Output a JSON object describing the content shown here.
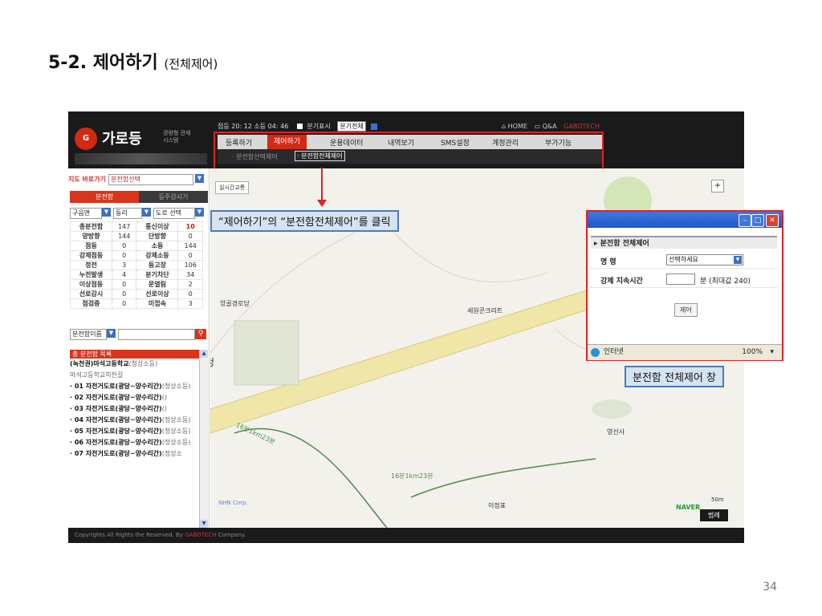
{
  "slide": {
    "title_main": "5-2. 제어하기",
    "title_sub": "(전체제어)",
    "page_number": "34"
  },
  "app": {
    "logo": {
      "mark": "G",
      "name": "가로등",
      "sub": "경량형 관제시스템"
    },
    "status": {
      "time_text": "점등 20: 12 소등 04: 46",
      "checkbox_label": "분기표시",
      "select_value": "분기전체"
    },
    "top_links": {
      "home": "HOME",
      "qa": "Q&A",
      "brand": "GABOTECH"
    },
    "menu": [
      "등록하기",
      "제어하기",
      "운용데이터",
      "내역보기",
      "SMS설정",
      "계정관리",
      "부가기능"
    ],
    "submenu": [
      "· 분전함선택제어",
      "· 분전함전체제어"
    ],
    "sidebar": {
      "goto_label": "지도 바로가기",
      "goto_select": "분전함선택",
      "tabs": [
        "분전함",
        "등주감시기"
      ],
      "filters": [
        "구읍면",
        "동리",
        "도로 선택"
      ],
      "stats": [
        [
          "총분전함",
          "147",
          "통신이상",
          "10"
        ],
        [
          "양방향",
          "144",
          "단방향",
          "0"
        ],
        [
          "점등",
          "0",
          "소등",
          "144"
        ],
        [
          "강제점등",
          "0",
          "강제소등",
          "0"
        ],
        [
          "정전",
          "3",
          "등고장",
          "106"
        ],
        [
          "누전발생",
          "4",
          "분기차단",
          "34"
        ],
        [
          "이상점등",
          "0",
          "문열림",
          "2"
        ],
        [
          "선로감시",
          "0",
          "선로이상",
          "0"
        ],
        [
          "점검중",
          "0",
          "미접속",
          "3"
        ]
      ],
      "search_select": "분전함이름",
      "search_icon": "search-icon",
      "list_header": "총 분전함 목록",
      "list_items": [
        {
          "name": "(녹천권)마석고등학교",
          "dist": "(청상소등)"
        },
        {
          "name": "",
          "dist": "마석고등학교히천길"
        },
        {
          "name": "· 01 자전거도로(광당~양수리간)",
          "dist": "(정상소등)"
        },
        {
          "name": "· 02 자전거도로(광당~양수리간)",
          "dist": "()"
        },
        {
          "name": "· 03 자전거도로(광당~양수리간)",
          "dist": "()"
        },
        {
          "name": "· 04 자전거도로(광당~양수리간)",
          "dist": "(정상소등)"
        },
        {
          "name": "· 05 자전거도로(광당~양수리간)",
          "dist": "(정상소등)"
        },
        {
          "name": "· 06 자전거도로(광당~양수리간)",
          "dist": "(정상소등)"
        },
        {
          "name": "· 07 자전거도로(광당~양수리간)",
          "dist": "(정상소"
        }
      ]
    },
    "map": {
      "realtime_button": "실시간교통",
      "labels": {
        "a": "앙골경로당",
        "b": "세원콘크리트",
        "c": "청",
        "d": "영선사",
        "e": "이정표",
        "f": "16분1km23분",
        "g": "16분1km23분"
      },
      "nhn": "NHN Corp.",
      "naver": "NAVER",
      "scale": "50m",
      "legend_button": "범례"
    },
    "footer": {
      "copyright": "Copyrights All Rights the Reserved. By",
      "brand": "GABOTECH",
      "company": "Company."
    }
  },
  "annotations": {
    "callout_click": "“제어하기”의 “분전함전체제어”를 클릭",
    "callout_window": "분전함 전체제어 창"
  },
  "popup": {
    "section_title": "분전함 전체제어",
    "command_label": "명 령",
    "command_value": "선택하세요",
    "duration_label": "강제 지속시간",
    "duration_value": "",
    "duration_unit": "분 (최대값 240)",
    "submit_label": "제어",
    "status_zone": "인터넷",
    "status_zoom": "100%"
  },
  "colors": {
    "accent_red": "#d8351c",
    "annotation_red": "#e0202a",
    "callout_bg": "#d6e3f1",
    "callout_border": "#4a7db5",
    "titlebar_blue": "#1f55c8"
  }
}
